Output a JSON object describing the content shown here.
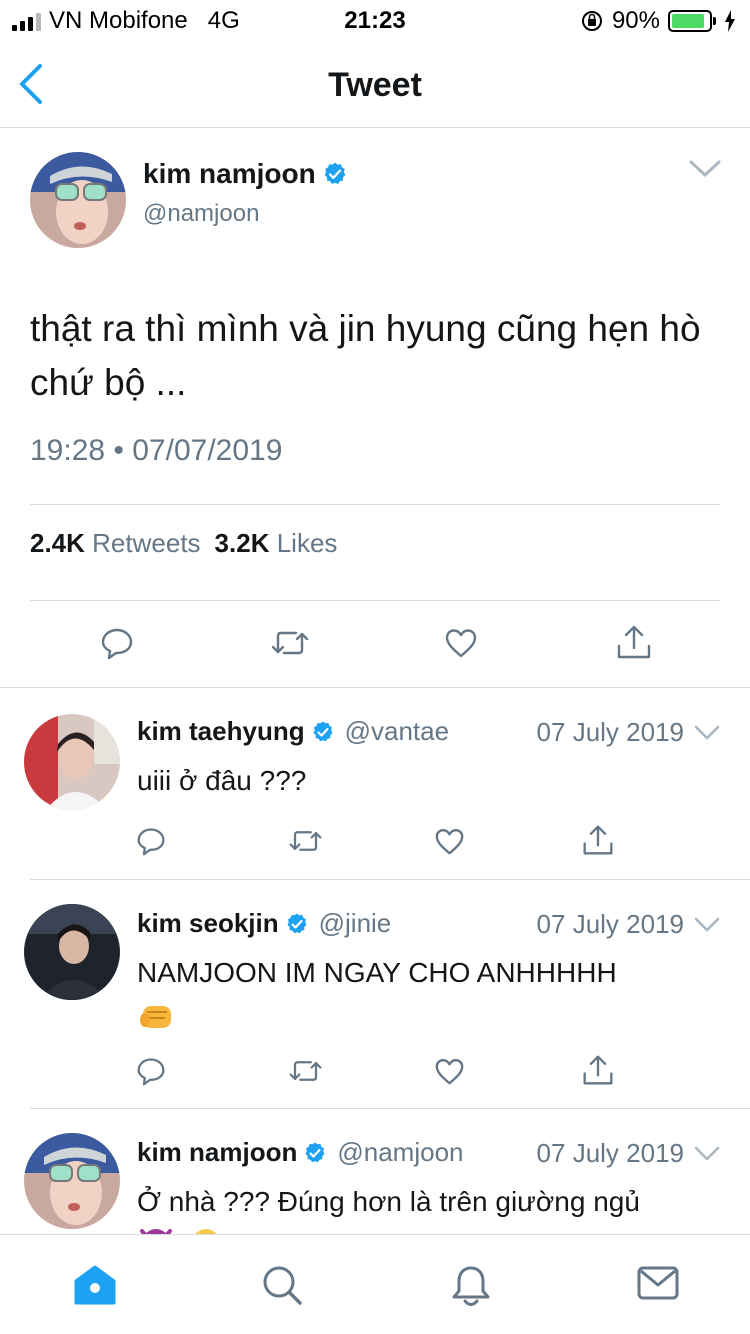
{
  "status_bar": {
    "carrier": "VN Mobifone",
    "network": "4G",
    "time": "21:23",
    "battery": "90%",
    "battery_level": 0.9
  },
  "header": {
    "title": "Tweet"
  },
  "main_tweet": {
    "name": "kim namjoon",
    "handle": "@namjoon",
    "text": "thật ra thì mình và jin hyung cũng hẹn hò chứ bộ ...",
    "timestamp": "19:28 • 07/07/2019",
    "retweets_count": "2.4K",
    "retweets_label": "Retweets",
    "likes_count": "3.2K",
    "likes_label": "Likes"
  },
  "replies": [
    {
      "name": "kim taehyung",
      "handle": "@vantae",
      "date": "07 July 2019",
      "text": "uiii ở đâu ???"
    },
    {
      "name": "kim seokjin",
      "handle": "@jinie",
      "date": "07 July 2019",
      "text": "NAMJOON IM NGAY CHO ANHHHHH"
    },
    {
      "name": "kim namjoon",
      "handle": "@namjoon",
      "date": "07 July 2019",
      "text": "Ở nhà ??? Đúng hơn là trên giường ngủ"
    }
  ],
  "colors": {
    "accent": "#1da1f2",
    "secondary": "#657786",
    "icon": "#657786",
    "verified": "#1da1f2"
  },
  "icons": [
    "back-chevron",
    "verified-badge",
    "chevron-down",
    "reply",
    "retweet",
    "like",
    "share",
    "home",
    "search",
    "notifications",
    "messages",
    "fist-emoji",
    "devil-emoji",
    "smile-emoji"
  ]
}
